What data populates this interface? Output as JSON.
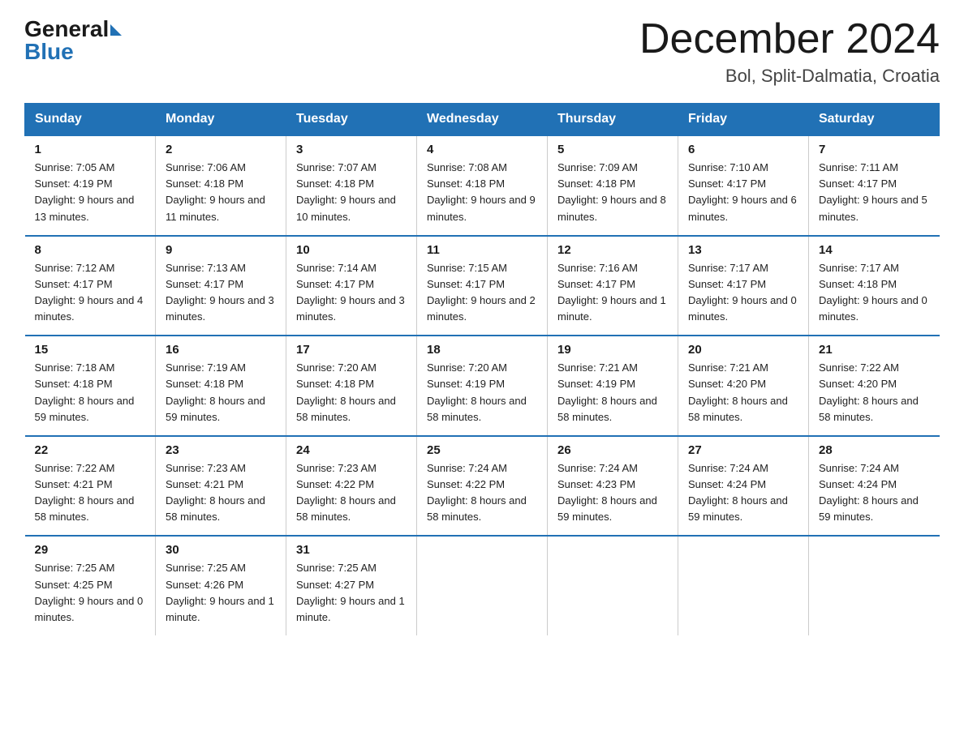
{
  "logo": {
    "general": "General",
    "blue": "Blue",
    "arrow": "▶"
  },
  "header": {
    "title": "December 2024",
    "subtitle": "Bol, Split-Dalmatia, Croatia"
  },
  "days_of_week": [
    "Sunday",
    "Monday",
    "Tuesday",
    "Wednesday",
    "Thursday",
    "Friday",
    "Saturday"
  ],
  "weeks": [
    [
      {
        "day": "1",
        "sunrise": "7:05 AM",
        "sunset": "4:19 PM",
        "daylight": "9 hours and 13 minutes."
      },
      {
        "day": "2",
        "sunrise": "7:06 AM",
        "sunset": "4:18 PM",
        "daylight": "9 hours and 11 minutes."
      },
      {
        "day": "3",
        "sunrise": "7:07 AM",
        "sunset": "4:18 PM",
        "daylight": "9 hours and 10 minutes."
      },
      {
        "day": "4",
        "sunrise": "7:08 AM",
        "sunset": "4:18 PM",
        "daylight": "9 hours and 9 minutes."
      },
      {
        "day": "5",
        "sunrise": "7:09 AM",
        "sunset": "4:18 PM",
        "daylight": "9 hours and 8 minutes."
      },
      {
        "day": "6",
        "sunrise": "7:10 AM",
        "sunset": "4:17 PM",
        "daylight": "9 hours and 6 minutes."
      },
      {
        "day": "7",
        "sunrise": "7:11 AM",
        "sunset": "4:17 PM",
        "daylight": "9 hours and 5 minutes."
      }
    ],
    [
      {
        "day": "8",
        "sunrise": "7:12 AM",
        "sunset": "4:17 PM",
        "daylight": "9 hours and 4 minutes."
      },
      {
        "day": "9",
        "sunrise": "7:13 AM",
        "sunset": "4:17 PM",
        "daylight": "9 hours and 3 minutes."
      },
      {
        "day": "10",
        "sunrise": "7:14 AM",
        "sunset": "4:17 PM",
        "daylight": "9 hours and 3 minutes."
      },
      {
        "day": "11",
        "sunrise": "7:15 AM",
        "sunset": "4:17 PM",
        "daylight": "9 hours and 2 minutes."
      },
      {
        "day": "12",
        "sunrise": "7:16 AM",
        "sunset": "4:17 PM",
        "daylight": "9 hours and 1 minute."
      },
      {
        "day": "13",
        "sunrise": "7:17 AM",
        "sunset": "4:17 PM",
        "daylight": "9 hours and 0 minutes."
      },
      {
        "day": "14",
        "sunrise": "7:17 AM",
        "sunset": "4:18 PM",
        "daylight": "9 hours and 0 minutes."
      }
    ],
    [
      {
        "day": "15",
        "sunrise": "7:18 AM",
        "sunset": "4:18 PM",
        "daylight": "8 hours and 59 minutes."
      },
      {
        "day": "16",
        "sunrise": "7:19 AM",
        "sunset": "4:18 PM",
        "daylight": "8 hours and 59 minutes."
      },
      {
        "day": "17",
        "sunrise": "7:20 AM",
        "sunset": "4:18 PM",
        "daylight": "8 hours and 58 minutes."
      },
      {
        "day": "18",
        "sunrise": "7:20 AM",
        "sunset": "4:19 PM",
        "daylight": "8 hours and 58 minutes."
      },
      {
        "day": "19",
        "sunrise": "7:21 AM",
        "sunset": "4:19 PM",
        "daylight": "8 hours and 58 minutes."
      },
      {
        "day": "20",
        "sunrise": "7:21 AM",
        "sunset": "4:20 PM",
        "daylight": "8 hours and 58 minutes."
      },
      {
        "day": "21",
        "sunrise": "7:22 AM",
        "sunset": "4:20 PM",
        "daylight": "8 hours and 58 minutes."
      }
    ],
    [
      {
        "day": "22",
        "sunrise": "7:22 AM",
        "sunset": "4:21 PM",
        "daylight": "8 hours and 58 minutes."
      },
      {
        "day": "23",
        "sunrise": "7:23 AM",
        "sunset": "4:21 PM",
        "daylight": "8 hours and 58 minutes."
      },
      {
        "day": "24",
        "sunrise": "7:23 AM",
        "sunset": "4:22 PM",
        "daylight": "8 hours and 58 minutes."
      },
      {
        "day": "25",
        "sunrise": "7:24 AM",
        "sunset": "4:22 PM",
        "daylight": "8 hours and 58 minutes."
      },
      {
        "day": "26",
        "sunrise": "7:24 AM",
        "sunset": "4:23 PM",
        "daylight": "8 hours and 59 minutes."
      },
      {
        "day": "27",
        "sunrise": "7:24 AM",
        "sunset": "4:24 PM",
        "daylight": "8 hours and 59 minutes."
      },
      {
        "day": "28",
        "sunrise": "7:24 AM",
        "sunset": "4:24 PM",
        "daylight": "8 hours and 59 minutes."
      }
    ],
    [
      {
        "day": "29",
        "sunrise": "7:25 AM",
        "sunset": "4:25 PM",
        "daylight": "9 hours and 0 minutes."
      },
      {
        "day": "30",
        "sunrise": "7:25 AM",
        "sunset": "4:26 PM",
        "daylight": "9 hours and 1 minute."
      },
      {
        "day": "31",
        "sunrise": "7:25 AM",
        "sunset": "4:27 PM",
        "daylight": "9 hours and 1 minute."
      },
      null,
      null,
      null,
      null
    ]
  ],
  "labels": {
    "sunrise": "Sunrise: ",
    "sunset": "Sunset: ",
    "daylight": "Daylight: "
  }
}
